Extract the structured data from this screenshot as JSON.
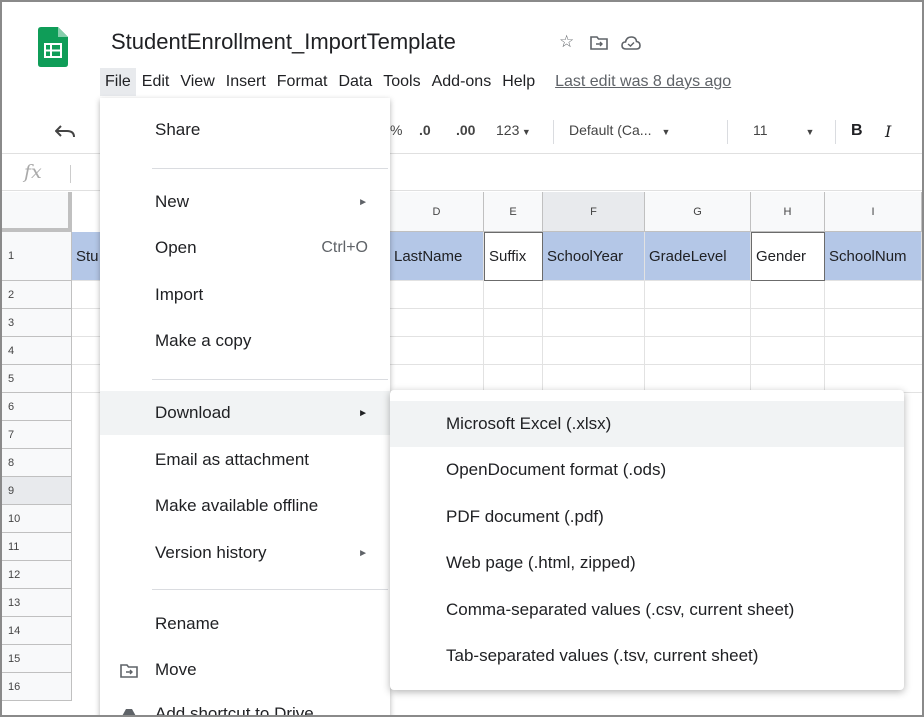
{
  "app": {
    "doc_title": "StudentEnrollment_ImportTemplate",
    "last_edit": "Last edit was 8 days ago"
  },
  "icons": {
    "logo": "google-sheets-logo",
    "star": "star-icon",
    "folder": "move-to-folder-icon",
    "cloud": "cloud-status-icon",
    "undo": "undo-icon",
    "fx": "fx-icon"
  },
  "menubar": [
    "File",
    "Edit",
    "View",
    "Insert",
    "Format",
    "Data",
    "Tools",
    "Add-ons",
    "Help"
  ],
  "toolbar": {
    "percent": "%",
    "dec_decrease": ".0",
    "dec_increase": ".00",
    "more_formats": "123",
    "font": "Default (Ca...",
    "font_size": "11",
    "bold": "B",
    "italic": "I"
  },
  "formula_bar": {
    "fx_label": "fx"
  },
  "grid": {
    "columns": [
      "D",
      "E",
      "F",
      "G",
      "H",
      "I"
    ],
    "rows": [
      "1",
      "2",
      "3",
      "4",
      "5",
      "6",
      "7",
      "8",
      "9",
      "10",
      "11",
      "12",
      "13",
      "14",
      "15",
      "16"
    ],
    "header_cells": {
      "a": "Stu",
      "d": "LastName",
      "e": "Suffix",
      "f": "SchoolYear",
      "g": "GradeLevel",
      "h": "Gender",
      "i": "SchoolNum"
    }
  },
  "file_menu": {
    "share": "Share",
    "new": "New",
    "open": "Open",
    "open_shortcut": "Ctrl+O",
    "import": "Import",
    "make_copy": "Make a copy",
    "download": "Download",
    "email_attachment": "Email as attachment",
    "make_offline": "Make available offline",
    "version_history": "Version history",
    "rename": "Rename",
    "move": "Move",
    "add_shortcut": "Add shortcut to Drive"
  },
  "download_menu": {
    "xlsx": "Microsoft Excel (.xlsx)",
    "ods": "OpenDocument format (.ods)",
    "pdf": "PDF document (.pdf)",
    "html": "Web page (.html, zipped)",
    "csv": "Comma-separated values (.csv, current sheet)",
    "tsv": "Tab-separated values (.tsv, current sheet)"
  },
  "colors": {
    "header_fill": "#b4c7e7",
    "sheets_green": "#0f9d58",
    "hover": "#f1f3f4"
  }
}
